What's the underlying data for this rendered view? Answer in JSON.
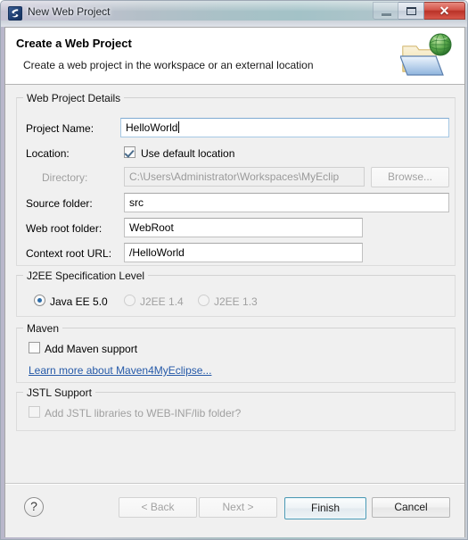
{
  "window": {
    "title": "New Web Project",
    "icon": "myeclipse-logo-icon",
    "buttons": {
      "minimize": "minimize-icon",
      "maximize": "maximize-icon",
      "close": "✕"
    }
  },
  "header": {
    "title": "Create a Web Project",
    "description": "Create a web project in the workspace or an external location",
    "icon": "web-folder-globe-icon"
  },
  "groups": {
    "details": {
      "legend": "Web Project Details",
      "project_name": {
        "label": "Project Name:",
        "value": "HelloWorld",
        "placeholder": ""
      },
      "location": {
        "label": "Location:",
        "checkbox_label": "Use default location",
        "checked": true
      },
      "directory": {
        "label": "Directory:",
        "value": "C:\\Users\\Administrator\\Workspaces\\MyEclip",
        "browse_label": "Browse...",
        "enabled": false
      },
      "source_folder": {
        "label": "Source folder:",
        "value": "src"
      },
      "web_root_folder": {
        "label": "Web root folder:",
        "value": "WebRoot"
      },
      "context_root_url": {
        "label": "Context root URL:",
        "value": "/HelloWorld"
      }
    },
    "j2ee": {
      "legend": "J2EE Specification Level",
      "options": [
        {
          "label": "Java EE 5.0",
          "selected": true,
          "enabled": true
        },
        {
          "label": "J2EE 1.4",
          "selected": false,
          "enabled": false
        },
        {
          "label": "J2EE 1.3",
          "selected": false,
          "enabled": false
        }
      ]
    },
    "maven": {
      "legend": "Maven",
      "checkbox_label": "Add Maven support",
      "checked": false,
      "link_label": "Learn more about Maven4MyEclipse..."
    },
    "jstl": {
      "legend": "JSTL Support",
      "checkbox_label": "Add JSTL libraries to WEB-INF/lib folder?",
      "checked": false,
      "enabled": false
    }
  },
  "footer": {
    "help": "?",
    "back": "< Back",
    "next": "Next >",
    "finish": "Finish",
    "cancel": "Cancel"
  },
  "colors": {
    "accent": "#2559a8",
    "default_button_border": "#4e9ab5",
    "close_button": "#b93227"
  }
}
